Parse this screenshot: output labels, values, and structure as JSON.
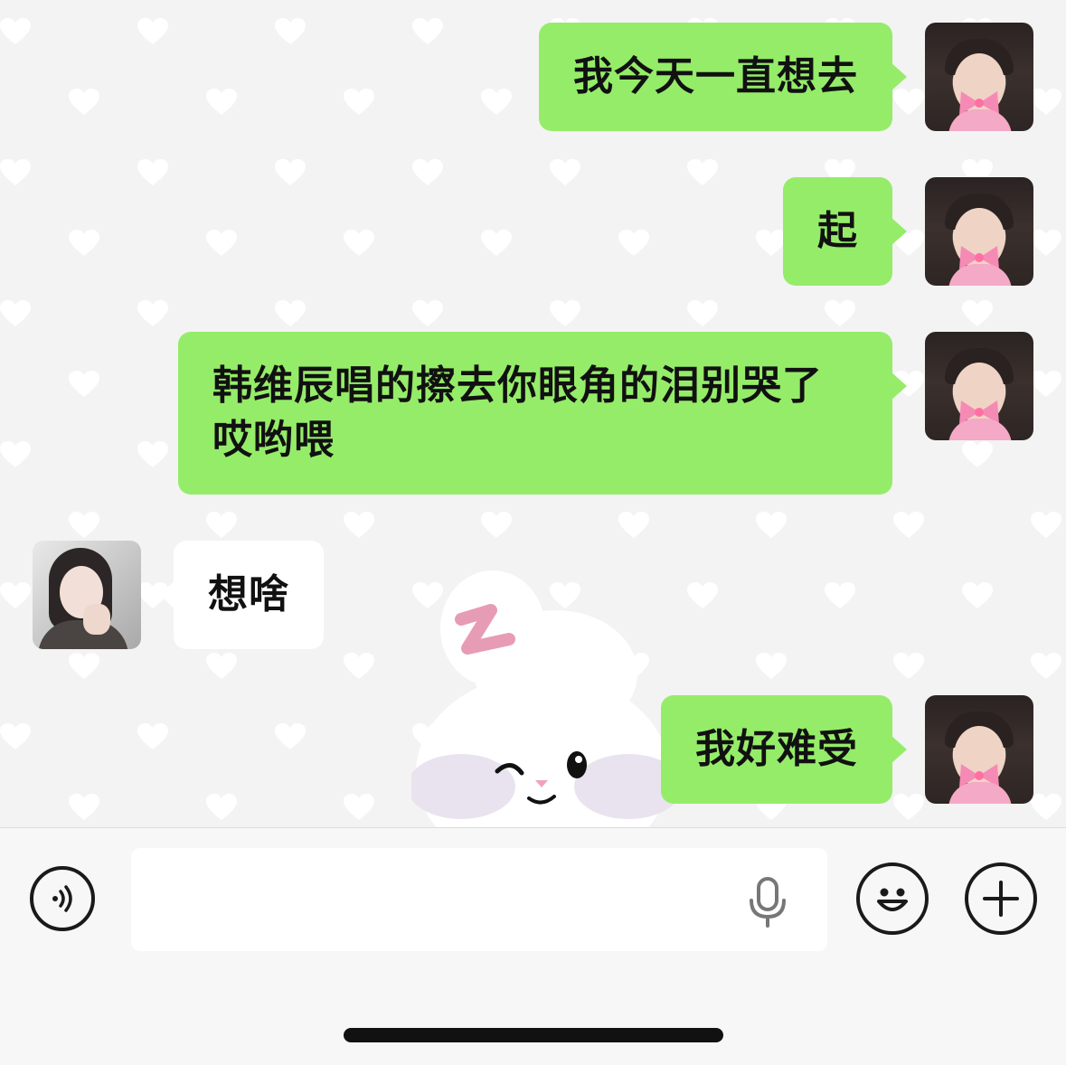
{
  "messages": [
    {
      "side": "out",
      "text": "我今天一直想去"
    },
    {
      "side": "out",
      "text": "起"
    },
    {
      "side": "out",
      "text": "韩维辰唱的擦去你眼角的泪别哭了哎哟喂"
    },
    {
      "side": "in",
      "text": "想啥"
    },
    {
      "side": "out",
      "text": "我好难受"
    }
  ],
  "input": {
    "value": ""
  },
  "icons": {
    "voice": "voice-mode-icon",
    "mic": "microphone-icon",
    "emoji": "emoji-icon",
    "plus": "plus-icon"
  },
  "colors": {
    "outgoing_bubble": "#95ec69",
    "incoming_bubble": "#ffffff",
    "background": "#f3f3f3"
  }
}
